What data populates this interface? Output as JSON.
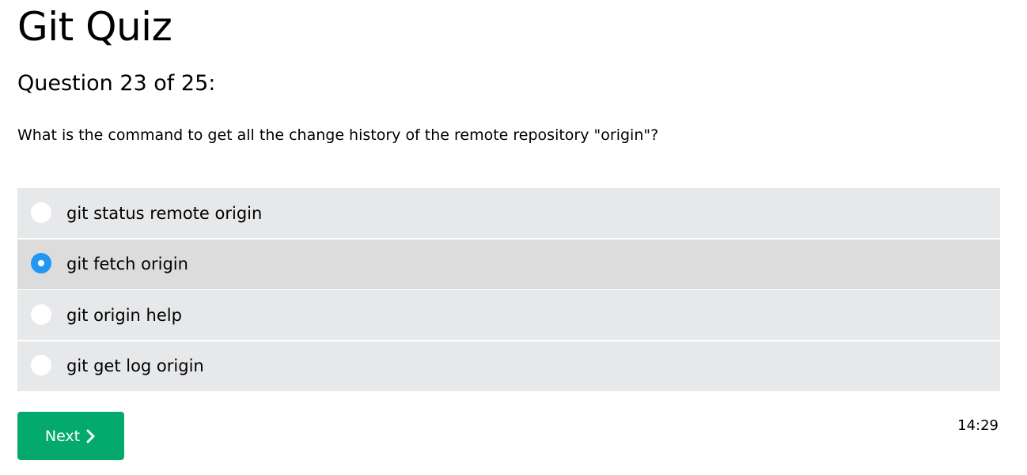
{
  "quiz": {
    "title": "Git Quiz",
    "question_number": "Question 23 of 25:",
    "question_text": "What is the command to get all the change history of the remote repository \"origin\"?",
    "options": [
      {
        "label": "git status remote origin",
        "selected": false
      },
      {
        "label": "git fetch origin",
        "selected": true
      },
      {
        "label": "git origin help",
        "selected": false
      },
      {
        "label": "git get log origin",
        "selected": false
      }
    ],
    "next_label": "Next",
    "next_icon": "chevron-right-icon",
    "timer": "14:29"
  },
  "colors": {
    "option_background": "#e7e8ea",
    "option_selected_background": "#dcdcdc",
    "radio_checked": "#2196f3",
    "next_button": "#04aa6d"
  }
}
